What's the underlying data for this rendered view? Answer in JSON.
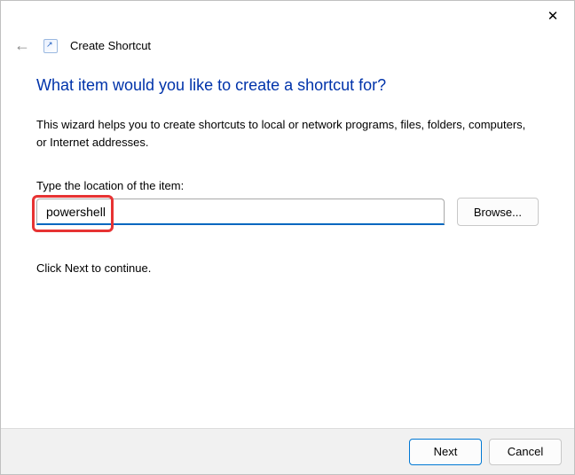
{
  "titlebar": {
    "close_glyph": "✕"
  },
  "header": {
    "back_glyph": "←",
    "title": "Create Shortcut"
  },
  "main": {
    "heading": "What item would you like to create a shortcut for?",
    "description": "This wizard helps you to create shortcuts to local or network programs, files, folders, computers, or Internet addresses.",
    "location_label": "Type the location of the item:",
    "location_value": "powershell",
    "browse_label": "Browse...",
    "continue_text": "Click Next to continue."
  },
  "footer": {
    "next_label": "Next",
    "cancel_label": "Cancel"
  }
}
